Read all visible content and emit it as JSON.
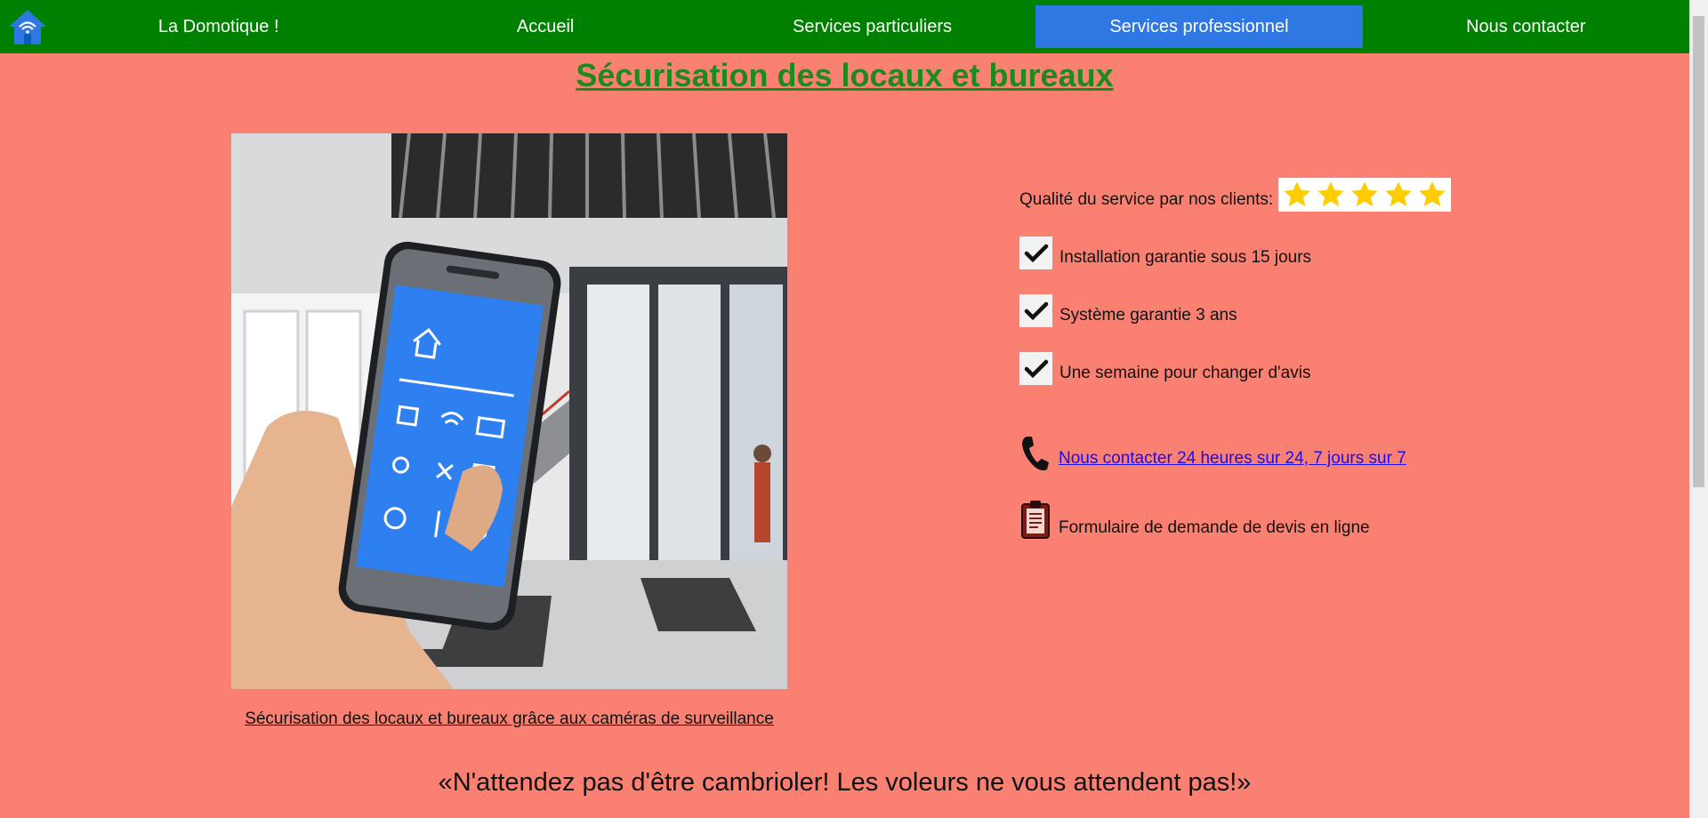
{
  "nav": {
    "items": [
      {
        "label": "La Domotique !"
      },
      {
        "label": "Accueil"
      },
      {
        "label": "Services particuliers"
      },
      {
        "label": "Services professionnel"
      },
      {
        "label": "Nous contacter"
      }
    ],
    "active_index": 3
  },
  "page": {
    "title": "Sécurisation des locaux et bureaux",
    "caption": "Sécurisation des locaux et bureaux grâce aux caméras de surveillance",
    "slogan": "«N'attendez pas d'être cambrioler! Les voleurs ne vous attendent pas!»"
  },
  "features": {
    "rating_label": "Qualité du service par nos clients:",
    "rating_stars": 5,
    "checks": [
      "Installation garantie sous 15 jours",
      "Système garantie 3 ans",
      "Une semaine pour changer d'avis"
    ],
    "contact_link": "Nous contacter 24 heures sur 24, 7 jours sur 7",
    "form_text": "Formulaire de demande de devis en ligne"
  },
  "colors": {
    "background": "#fa8072",
    "nav": "#008000",
    "nav_active": "#2f78e4",
    "title": "#1d8a1d",
    "star": "#ffcc00",
    "link": "#1a0dee"
  },
  "icons": {
    "logo": "smart-home-icon",
    "star": "star-icon",
    "check": "checkmark-icon",
    "phone": "phone-icon",
    "form": "clipboard-icon"
  }
}
